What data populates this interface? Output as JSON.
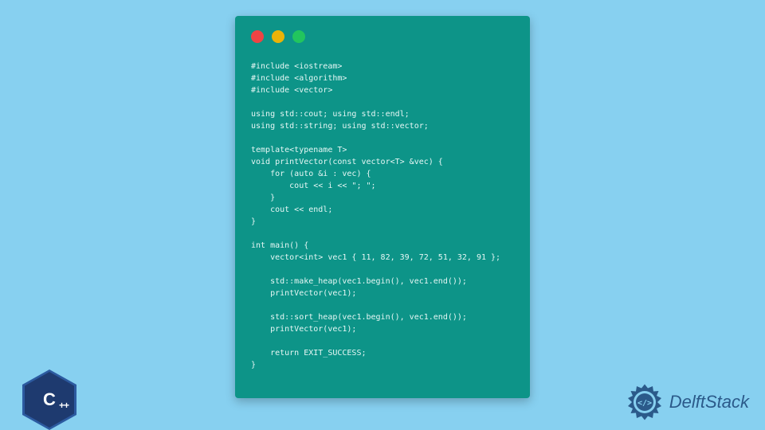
{
  "code_window": {
    "traffic_lights": [
      "red",
      "yellow",
      "green"
    ],
    "code": "#include <iostream>\n#include <algorithm>\n#include <vector>\n\nusing std::cout; using std::endl;\nusing std::string; using std::vector;\n\ntemplate<typename T>\nvoid printVector(const vector<T> &vec) {\n    for (auto &i : vec) {\n        cout << i << \"; \";\n    }\n    cout << endl;\n}\n\nint main() {\n    vector<int> vec1 { 11, 82, 39, 72, 51, 32, 91 };\n\n    std::make_heap(vec1.begin(), vec1.end());\n    printVector(vec1);\n\n    std::sort_heap(vec1.begin(), vec1.end());\n    printVector(vec1);\n\n    return EXIT_SUCCESS;\n}"
  },
  "cpp_badge": {
    "main": "C",
    "suffix": "++"
  },
  "delft": {
    "text": "DelftStack"
  }
}
